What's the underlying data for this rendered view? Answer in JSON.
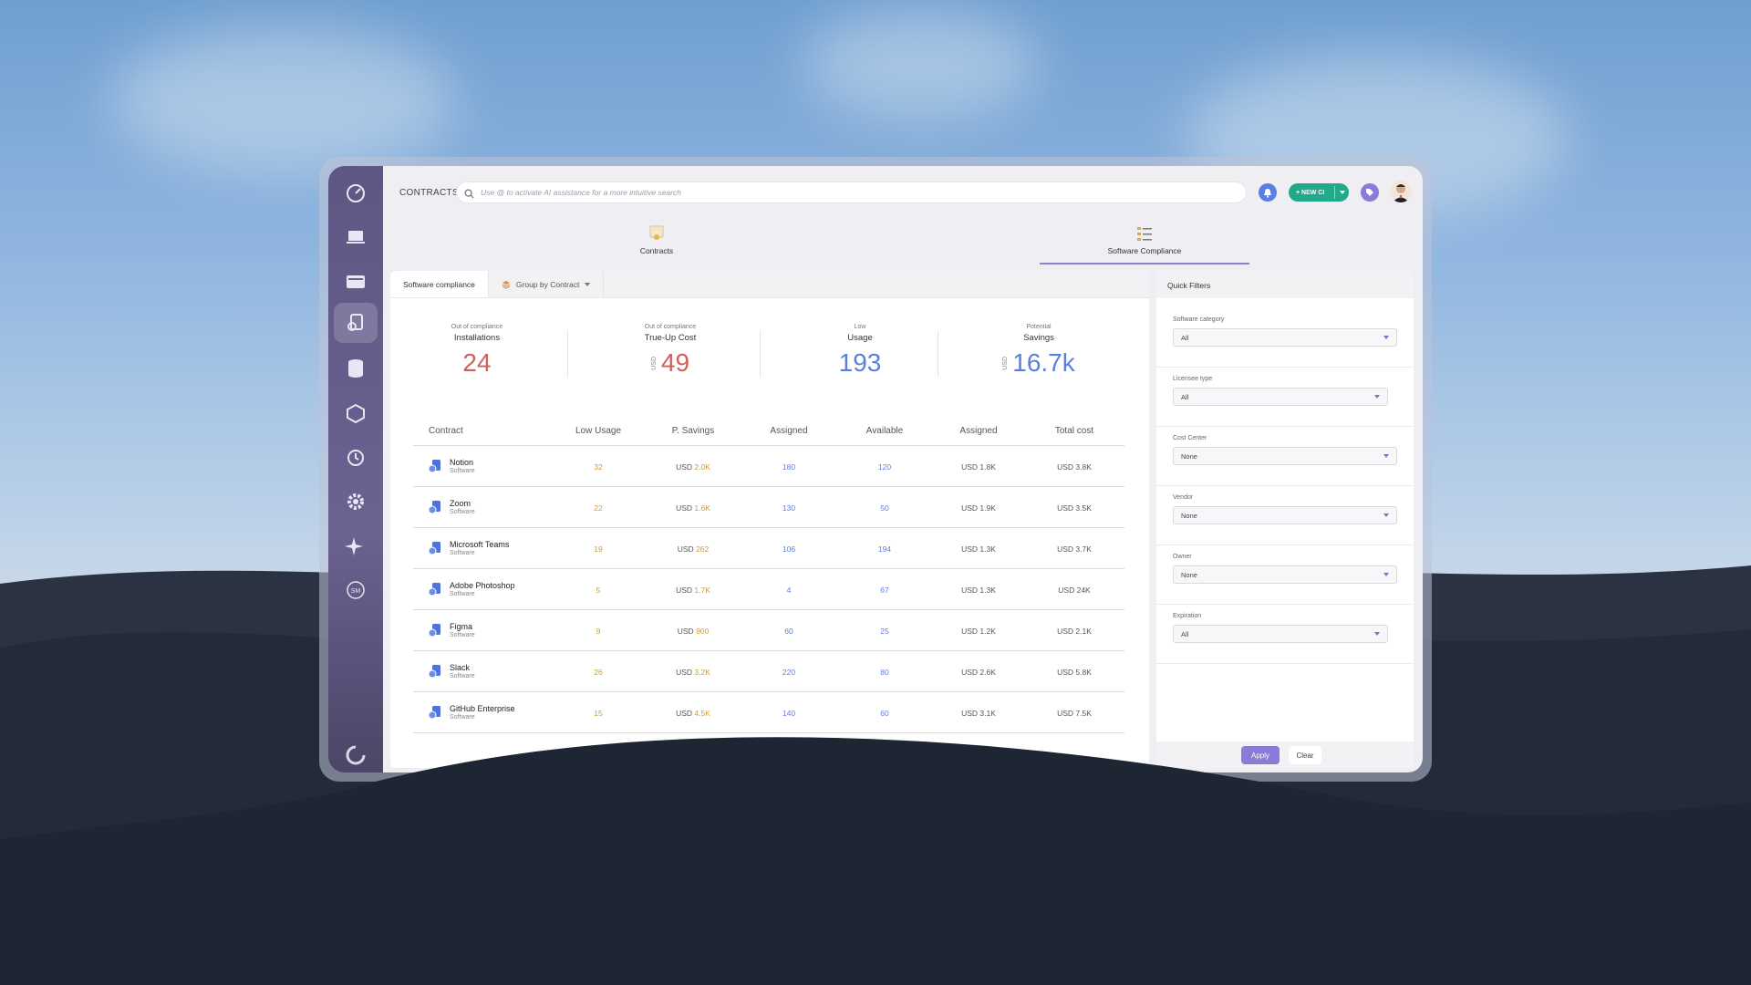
{
  "header": {
    "breadcrumb": "CONTRACTS",
    "search_placeholder": "Use @ to activate AI assistance for a more intuitive search",
    "new_button_label": "+ NEW CI"
  },
  "sidebar": {
    "items": [
      {
        "icon": "dashboard-icon"
      },
      {
        "icon": "laptop-icon"
      },
      {
        "icon": "server-icon"
      },
      {
        "icon": "contracts-icon",
        "active": true
      },
      {
        "icon": "database-icon"
      },
      {
        "icon": "package-icon"
      },
      {
        "icon": "history-icon"
      },
      {
        "icon": "settings-icon"
      },
      {
        "icon": "sparkle-icon"
      },
      {
        "icon": "sm-icon",
        "text": "SM"
      }
    ]
  },
  "tabs": [
    {
      "label": "Contracts",
      "icon": "certificate-icon"
    },
    {
      "label": "Software Compliance",
      "icon": "list-icon",
      "active": true
    }
  ],
  "subtabs": {
    "active": "Software compliance",
    "group": "Group by Contract"
  },
  "kpis": [
    {
      "top": "Out of compliance",
      "label": "Installations",
      "value": "24",
      "currency": "",
      "color": "#d0605a"
    },
    {
      "top": "Out of compliance",
      "label": "True-Up Cost",
      "value": "49",
      "currency": "USD",
      "color": "#d0605a"
    },
    {
      "top": "Low",
      "label": "Usage",
      "value": "193",
      "currency": "",
      "color": "#5b7fe0"
    },
    {
      "top": "Potential",
      "label": "Savings",
      "value": "16.7k",
      "currency": "USD",
      "color": "#5b7fe0"
    }
  ],
  "table": {
    "headers": [
      "Contract",
      "Low Usage",
      "P. Savings",
      "Assigned",
      "Available",
      "Assigned",
      "Total cost"
    ],
    "rows": [
      {
        "name": "Notion",
        "type": "Software",
        "low": "32",
        "savings": "2.0K",
        "assigned": "180",
        "available": "120",
        "assigned_cost": "1.8K",
        "total": "3.8K"
      },
      {
        "name": "Zoom",
        "type": "Software",
        "low": "22",
        "savings": "1.6K",
        "assigned": "130",
        "available": "50",
        "assigned_cost": "1.9K",
        "total": "3.5K"
      },
      {
        "name": "Microsoft Teams",
        "type": "Software",
        "low": "19",
        "savings": "262",
        "assigned": "106",
        "available": "194",
        "assigned_cost": "1.3K",
        "total": "3.7K"
      },
      {
        "name": "Adobe Photoshop",
        "type": "Software",
        "low": "5",
        "savings": "1.7K",
        "assigned": "4",
        "available": "67",
        "assigned_cost": "1.3K",
        "total": "24K"
      },
      {
        "name": "Figma",
        "type": "Software",
        "low": "9",
        "savings": "900",
        "assigned": "60",
        "available": "25",
        "assigned_cost": "1.2K",
        "total": "2.1K"
      },
      {
        "name": "Slack",
        "type": "Software",
        "low": "26",
        "savings": "3.2K",
        "assigned": "220",
        "available": "80",
        "assigned_cost": "2.6K",
        "total": "5.8K"
      },
      {
        "name": "GitHub Enterprise",
        "type": "Software",
        "low": "15",
        "savings": "4.5K",
        "assigned": "140",
        "available": "60",
        "assigned_cost": "3.1K",
        "total": "7.5K"
      }
    ],
    "currency": "USD"
  },
  "filters": {
    "title": "Quick Filters",
    "groups": [
      {
        "label": "Software category",
        "value": "All"
      },
      {
        "label": "Licensee type",
        "value": "All"
      },
      {
        "label": "Cost Center",
        "value": "None"
      },
      {
        "label": "Vendor",
        "value": "None"
      },
      {
        "label": "Owner",
        "value": "None"
      },
      {
        "label": "Expiration",
        "value": "All"
      }
    ],
    "apply_label": "Apply",
    "clear_label": "Clear"
  }
}
